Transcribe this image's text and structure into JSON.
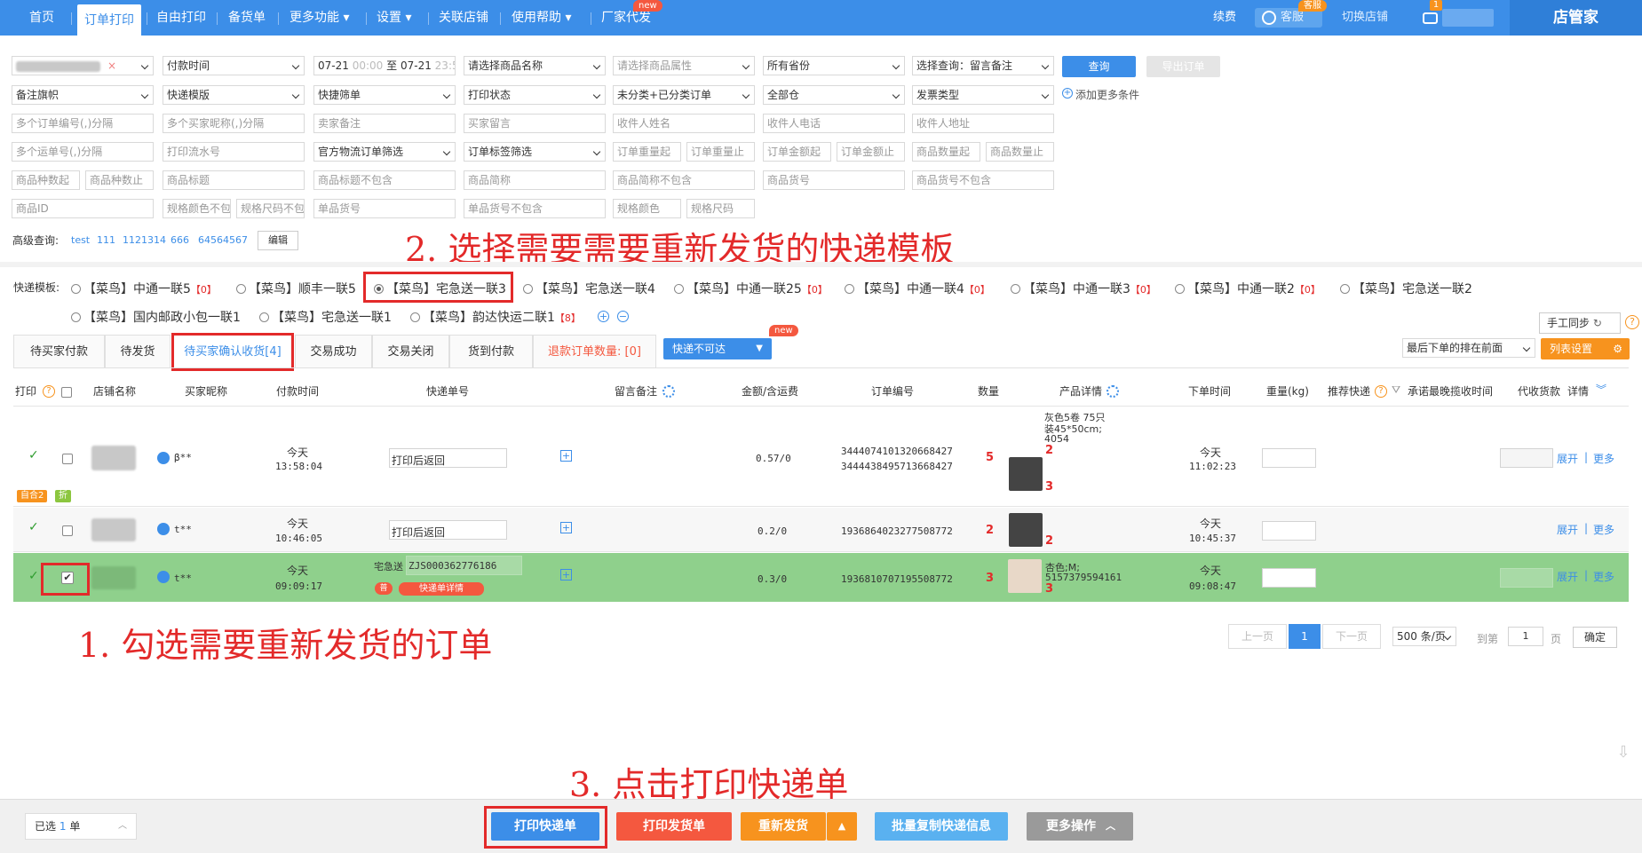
{
  "nav": {
    "items": [
      "首页",
      "订单打印",
      "自由打印",
      "备货单",
      "更多功能 ▾",
      "设置 ▾",
      "关联店铺",
      "使用帮助 ▾",
      "厂家代发"
    ],
    "new_badge": "new",
    "right": {
      "renew": "续费",
      "service": "客服",
      "service_badge": "客服",
      "switch_store": "切换店铺",
      "msg_count": "1",
      "brand": "店管家"
    }
  },
  "filters": {
    "row1": {
      "pay_time": "付款时间",
      "date_from": "07-21",
      "time_from": "00:00",
      "to": "至",
      "date_to": "07-21",
      "time_to": "23:59",
      "product_name": "请选择商品名称",
      "product_attr": "请选择商品属性",
      "province": "所有省份",
      "query_select": "选择查询：留言备注",
      "query_btn": "查询",
      "export_btn": "导出订单"
    },
    "row2": [
      "备注旗帜",
      "快递模版",
      "快捷筛单",
      "打印状态",
      "未分类+已分类订单",
      "全部仓",
      "发票类型"
    ],
    "add_more": "添加更多条件",
    "row3": [
      "多个订单编号(,)分隔",
      "多个买家昵称(,)分隔",
      "卖家备注",
      "买家留言",
      "收件人姓名",
      "收件人电话",
      "收件人地址"
    ],
    "row4": [
      "多个运单号(,)分隔",
      "打印流水号",
      "官方物流订单筛选",
      "订单标签筛选",
      "订单重量起",
      "订单重量止",
      "订单金额起",
      "订单金额止",
      "商品数量起",
      "商品数量止"
    ],
    "row5": [
      "商品种数起",
      "商品种数止",
      "商品标题",
      "商品标题不包含",
      "商品简称",
      "商品简称不包含",
      "商品货号",
      "商品货号不包含"
    ],
    "row6": [
      "商品ID",
      "规格颜色不包",
      "规格尺码不包",
      "单品货号",
      "单品货号不包含",
      "规格颜色",
      "规格尺码"
    ],
    "advanced": {
      "label": "高级查询:",
      "links": [
        "test",
        "111",
        "1121314",
        "666",
        "64564567"
      ],
      "edit": "编辑"
    }
  },
  "annotations": {
    "step1": "1. 勾选需要重新发货的订单",
    "step2": "2. 选择需要需要重新发货的快递模板",
    "step3": "3. 点击打印快递单"
  },
  "templates": {
    "label": "快递模板:",
    "items": [
      {
        "name": "【菜鸟】中通一联5",
        "count": "【0】",
        "selected": false
      },
      {
        "name": "【菜鸟】顺丰一联5",
        "count": "",
        "selected": false
      },
      {
        "name": "【菜鸟】宅急送一联3",
        "count": "",
        "selected": true
      },
      {
        "name": "【菜鸟】宅急送一联4",
        "count": "",
        "selected": false
      },
      {
        "name": "【菜鸟】中通一联25",
        "count": "【0】",
        "selected": false
      },
      {
        "name": "【菜鸟】中通一联4",
        "count": "【0】",
        "selected": false
      },
      {
        "name": "【菜鸟】中通一联3",
        "count": "【0】",
        "selected": false
      },
      {
        "name": "【菜鸟】中通一联2",
        "count": "【0】",
        "selected": false
      },
      {
        "name": "【菜鸟】宅急送一联2",
        "count": "",
        "selected": false
      },
      {
        "name": "【菜鸟】国内邮政小包一联1",
        "count": "",
        "selected": false
      },
      {
        "name": "【菜鸟】宅急送一联1",
        "count": "",
        "selected": false
      },
      {
        "name": "【菜鸟】韵达快运二联1",
        "count": "【8】",
        "selected": false
      }
    ],
    "manual_sync": "手工同步"
  },
  "tabs": {
    "items": [
      "待买家付款",
      "待发货",
      "待买家确认收货[4]",
      "交易成功",
      "交易关闭",
      "货到付款"
    ],
    "refund": "退款订单数量: [0]",
    "unreachable": "快递不可达",
    "new": "new",
    "sort": "最后下单的排在前面",
    "column_settings": "列表设置"
  },
  "columns": [
    "打印",
    "店铺名称",
    "买家昵称",
    "付款时间",
    "快递单号",
    "留言备注",
    "金额/含运费",
    "订单编号",
    "数量",
    "产品详情",
    "下单时间",
    "重量(kg)",
    "推荐快递",
    "承诺最晚揽收时间",
    "代收货款",
    "详情"
  ],
  "rows": [
    {
      "buyer": "β**",
      "pay_day": "今天",
      "pay_time": "13:58:04",
      "express_no": "打印后返回",
      "express_name": "",
      "amount": "0.57/0",
      "order_no_1": "3444074101320668427",
      "order_no_2": "3444438495713668427",
      "qty": "5",
      "product": [
        "灰色5卷 75只",
        "装45*50cm;",
        "4054"
      ],
      "p_qty_1": "2",
      "p_qty_2": "3",
      "order_day": "今天",
      "order_time": "11:02:23",
      "tags": [
        "自合2",
        "折"
      ],
      "expand": "展开",
      "more": "更多"
    },
    {
      "buyer": "t**",
      "pay_day": "今天",
      "pay_time": "10:46:05",
      "express_no": "打印后返回",
      "express_name": "",
      "amount": "0.2/0",
      "order_no_1": "1936864023277508772",
      "order_no_2": "",
      "qty": "2",
      "product": [],
      "p_qty_1": "2",
      "p_qty_2": "",
      "order_day": "今天",
      "order_time": "10:45:37",
      "tags": [],
      "expand": "展开",
      "more": "更多"
    },
    {
      "buyer": "t**",
      "pay_day": "今天",
      "pay_time": "09:09:17",
      "express_no": "ZJS000362776186",
      "express_name": "宅急送",
      "amount": "0.3/0",
      "order_no_1": "1936810707195508772",
      "order_no_2": "",
      "qty": "3",
      "product": [
        "杏色;M;",
        "5157379594161"
      ],
      "p_qty_1": "3",
      "p_qty_2": "",
      "order_day": "今天",
      "order_time": "09:08:47",
      "tags": [],
      "expand": "展开",
      "more": "更多",
      "detail_btn": "快递单详情",
      "tag_small": "普"
    }
  ],
  "pagination": {
    "prev": "上一页",
    "current": "1",
    "next": "下一页",
    "per_page": "500 条/页",
    "goto": "到第",
    "page_val": "1",
    "page_unit": "页",
    "confirm": "确定"
  },
  "bottom": {
    "selected": "已选",
    "count": "1",
    "unit": "单",
    "print_express": "打印快递单",
    "print_invoice": "打印发货单",
    "reship": "重新发货",
    "batch_copy": "批量复制快递信息",
    "more_ops": "更多操作"
  },
  "colors": {
    "primary": "#3c8ee8",
    "selected_row": "#8fd08c",
    "annotation": "#e32a2a",
    "print_invoice": "#f4583f",
    "reship": "#f7931e",
    "batch_copy": "#5ab1f0",
    "more_ops": "#9a9a9a"
  }
}
